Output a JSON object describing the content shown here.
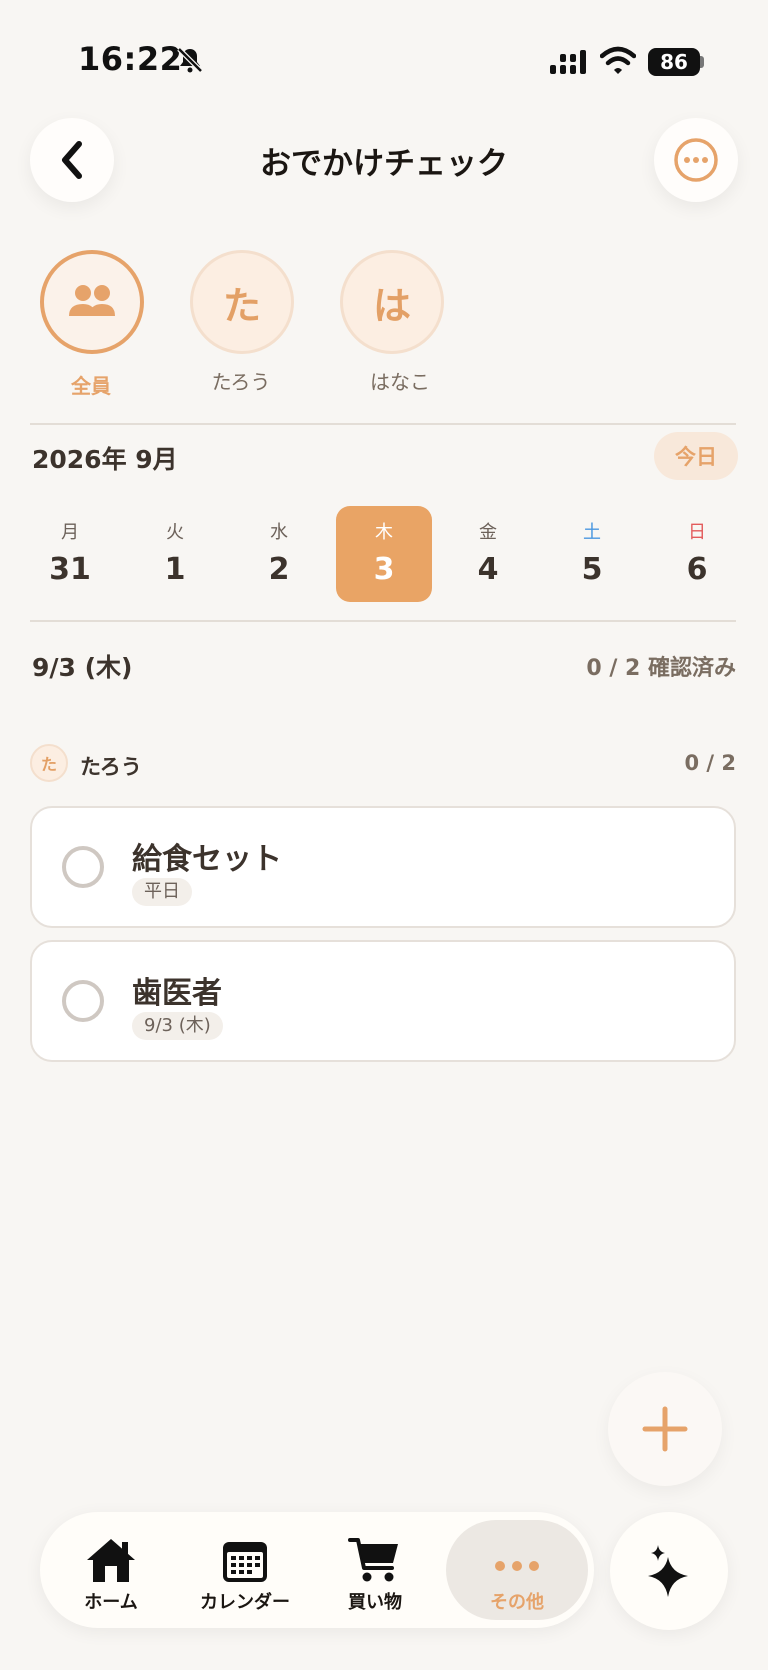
{
  "status_bar": {
    "time": "16:22",
    "battery": "86"
  },
  "header": {
    "title": "おでかけチェック"
  },
  "members": [
    {
      "label": "全員",
      "initial": "",
      "active": true
    },
    {
      "label": "たろう",
      "initial": "た",
      "active": false
    },
    {
      "label": "はなこ",
      "initial": "は",
      "active": false
    }
  ],
  "calendar": {
    "month": "2026年 9月",
    "today_label": "今日",
    "days": [
      {
        "weekday": "月",
        "date": "31"
      },
      {
        "weekday": "火",
        "date": "1"
      },
      {
        "weekday": "水",
        "date": "2"
      },
      {
        "weekday": "木",
        "date": "3",
        "selected": true
      },
      {
        "weekday": "金",
        "date": "4"
      },
      {
        "weekday": "土",
        "date": "5"
      },
      {
        "weekday": "日",
        "date": "6"
      }
    ]
  },
  "day_summary": {
    "date_label": "9/3 (木)",
    "confirmed": "0 / 2 確認済み"
  },
  "person_section": {
    "initial": "た",
    "name": "たろう",
    "count": "0 / 2",
    "items": [
      {
        "title": "給食セット",
        "tag": "平日",
        "checked": false
      },
      {
        "title": "歯医者",
        "tag": "9/3 (木)",
        "checked": false
      }
    ]
  },
  "tabbar": {
    "tabs": [
      {
        "label": "ホーム",
        "icon": "home-icon"
      },
      {
        "label": "カレンダー",
        "icon": "calendar-icon"
      },
      {
        "label": "買い物",
        "icon": "cart-icon"
      },
      {
        "label": "その他",
        "icon": "more-icon",
        "active": true
      }
    ]
  },
  "colors": {
    "accent": "#e9a465",
    "background": "#f8f6f3",
    "saturday": "#4b98e0",
    "sunday": "#e35b5b"
  }
}
